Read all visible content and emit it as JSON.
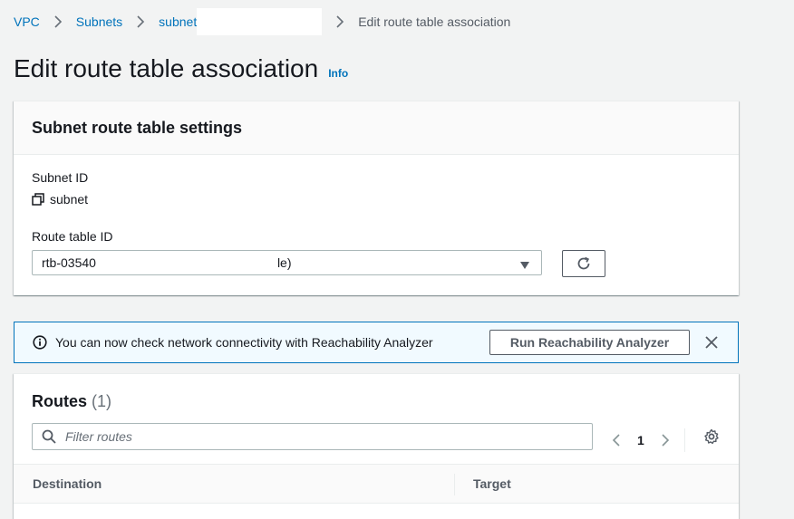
{
  "breadcrumb": {
    "items": [
      "VPC",
      "Subnets",
      "subnet"
    ],
    "current": "Edit route table association"
  },
  "page": {
    "title": "Edit route table association",
    "info_label": "Info"
  },
  "settings": {
    "header": "Subnet route table settings",
    "subnet_id_label": "Subnet ID",
    "subnet_id_value": "subnet",
    "route_table_label": "Route table ID",
    "route_table_value_start": "rtb-03540",
    "route_table_value_end": "le)"
  },
  "flash": {
    "message": "You can now check network connectivity with Reachability Analyzer",
    "button_label": "Run Reachability Analyzer",
    "color": "#0073bb"
  },
  "routes": {
    "title": "Routes",
    "count": "(1)",
    "filter_placeholder": "Filter routes",
    "page_number": "1",
    "columns": [
      "Destination",
      "Target"
    ]
  },
  "colors": {
    "link": "#0073bb",
    "text": "#16191f",
    "background": "#f2f3f3"
  }
}
